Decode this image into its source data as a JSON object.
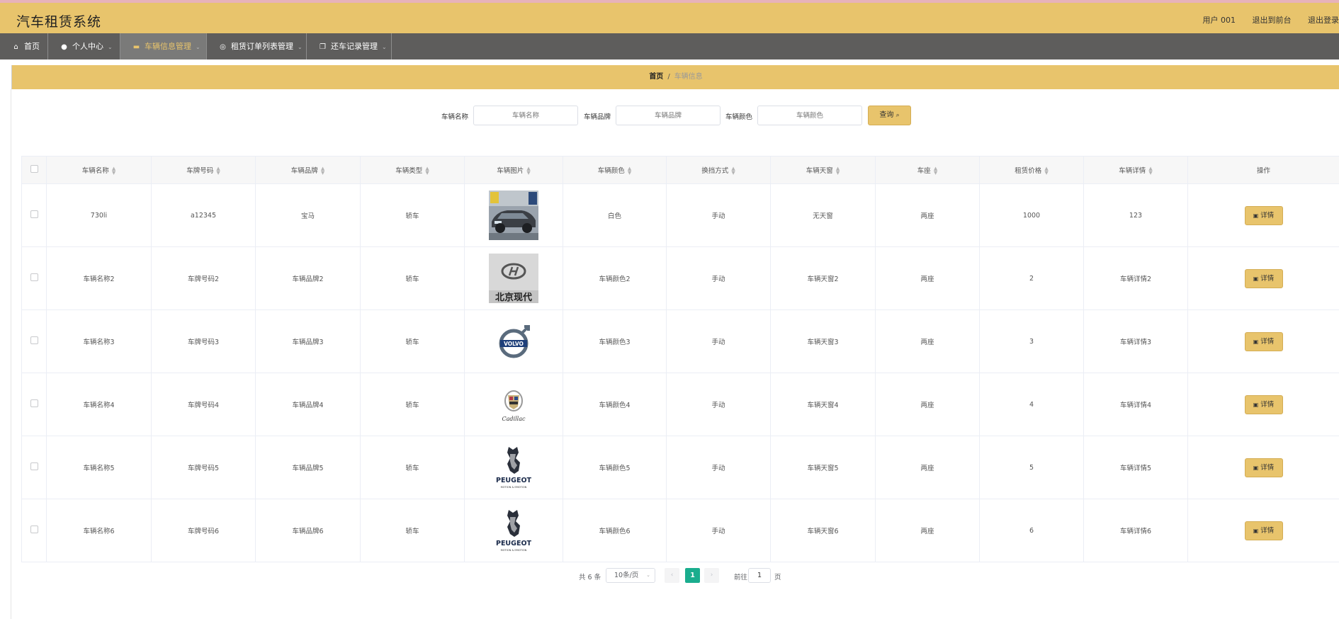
{
  "app": {
    "title": "汽车租赁系统"
  },
  "header": {
    "user": "用户 001",
    "exit_front": "退出到前台",
    "logout": "退出登录"
  },
  "nav": [
    {
      "label": "首页",
      "icon": "home-icon"
    },
    {
      "label": "个人中心",
      "icon": "user-icon"
    },
    {
      "label": "车辆信息管理",
      "icon": "car-icon"
    },
    {
      "label": "租赁订单列表管理",
      "icon": "compass-icon"
    },
    {
      "label": "还车记录管理",
      "icon": "copy-icon"
    }
  ],
  "breadcrumb": {
    "home": "首页",
    "sep": "/",
    "current": "车辆信息"
  },
  "search": {
    "name_label": "车辆名称",
    "name_placeholder": "车辆名称",
    "brand_label": "车辆品牌",
    "brand_placeholder": "车辆品牌",
    "color_label": "车辆颜色",
    "color_placeholder": "车辆颜色",
    "button": "查询"
  },
  "table": {
    "headers": [
      "车辆名称",
      "车牌号码",
      "车辆品牌",
      "车辆类型",
      "车辆图片",
      "车辆颜色",
      "换挡方式",
      "车辆天窗",
      "车座",
      "租赁价格",
      "车辆详情",
      "操作"
    ],
    "detail_label": "详情",
    "rows": [
      {
        "name": "730li",
        "plate": "a12345",
        "brand": "宝马",
        "type": "轿车",
        "image": "gray-sports-car",
        "color": "白色",
        "gear": "手动",
        "sunroof": "无天窗",
        "seats": "两座",
        "price": "1000",
        "detail": "123"
      },
      {
        "name": "车辆名称2",
        "plate": "车牌号码2",
        "brand": "车辆品牌2",
        "type": "轿车",
        "image": "beijing-hyundai-logo",
        "logo_text": "北京现代",
        "color": "车辆颜色2",
        "gear": "手动",
        "sunroof": "车辆天窗2",
        "seats": "两座",
        "price": "2",
        "detail": "车辆详情2"
      },
      {
        "name": "车辆名称3",
        "plate": "车牌号码3",
        "brand": "车辆品牌3",
        "type": "轿车",
        "image": "volvo-logo",
        "logo_text": "VOLVO",
        "color": "车辆颜色3",
        "gear": "手动",
        "sunroof": "车辆天窗3",
        "seats": "两座",
        "price": "3",
        "detail": "车辆详情3"
      },
      {
        "name": "车辆名称4",
        "plate": "车牌号码4",
        "brand": "车辆品牌4",
        "type": "轿车",
        "image": "cadillac-logo",
        "logo_text": "Cadillac",
        "color": "车辆颜色4",
        "gear": "手动",
        "sunroof": "车辆天窗4",
        "seats": "两座",
        "price": "4",
        "detail": "车辆详情4"
      },
      {
        "name": "车辆名称5",
        "plate": "车牌号码5",
        "brand": "车辆品牌5",
        "type": "轿车",
        "image": "peugeot-logo",
        "logo_text": "PEUGEOT",
        "logo_sub": "MOTION & EMOTION",
        "color": "车辆颜色5",
        "gear": "手动",
        "sunroof": "车辆天窗5",
        "seats": "两座",
        "price": "5",
        "detail": "车辆详情5"
      },
      {
        "name": "车辆名称6",
        "plate": "车牌号码6",
        "brand": "车辆品牌6",
        "type": "轿车",
        "image": "peugeot-logo",
        "logo_text": "PEUGEOT",
        "logo_sub": "MOTION & EMOTION",
        "color": "车辆颜色6",
        "gear": "手动",
        "sunroof": "车辆天窗6",
        "seats": "两座",
        "price": "6",
        "detail": "车辆详情6"
      }
    ]
  },
  "pagination": {
    "total": "共 6 条",
    "page_size": "10条/页",
    "current": "1",
    "goto_label": "前往",
    "goto_value": "1",
    "page_unit": "页"
  },
  "colors": {
    "accent": "#e8c46c",
    "nav_bg": "#5e5d5c",
    "pager_active": "#1aad8e"
  }
}
